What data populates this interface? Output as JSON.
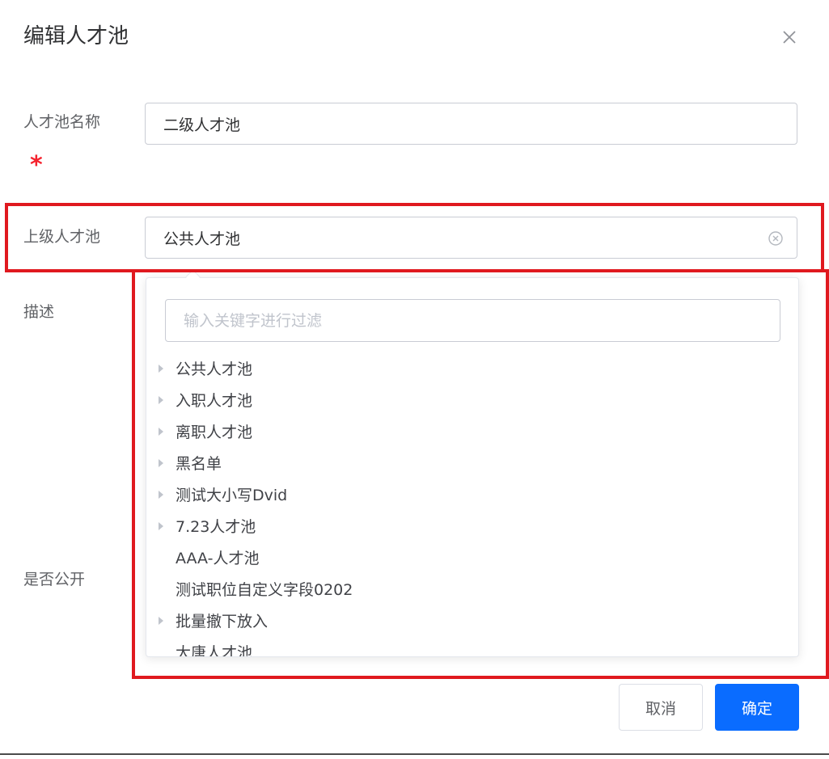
{
  "dialog": {
    "title": "编辑人才池",
    "close_icon": "close-icon"
  },
  "form": {
    "name_label": "人才池名称",
    "name_value": "二级人才池",
    "required_mark": "*",
    "parent_label": "上级人才池",
    "parent_value": "公共人才池",
    "description_label": "描述",
    "public_label": "是否公开"
  },
  "dropdown": {
    "filter_placeholder": "输入关键字进行过滤",
    "items": [
      {
        "label": "公共人才池",
        "has_children": true
      },
      {
        "label": "入职人才池",
        "has_children": true
      },
      {
        "label": "离职人才池",
        "has_children": true
      },
      {
        "label": "黑名单",
        "has_children": true
      },
      {
        "label": "测试大小写Dvid",
        "has_children": true
      },
      {
        "label": "7.23人才池",
        "has_children": true
      },
      {
        "label": "AAA-人才池",
        "has_children": false
      },
      {
        "label": "测试职位自定义字段0202",
        "has_children": false
      },
      {
        "label": "批量撤下放入",
        "has_children": true
      },
      {
        "label": "大唐人才池",
        "has_children": false
      }
    ]
  },
  "footer": {
    "cancel_label": "取消",
    "confirm_label": "确定"
  },
  "colors": {
    "primary": "#0a6cff",
    "highlight": "#e0191f",
    "required": "#f5222d"
  }
}
